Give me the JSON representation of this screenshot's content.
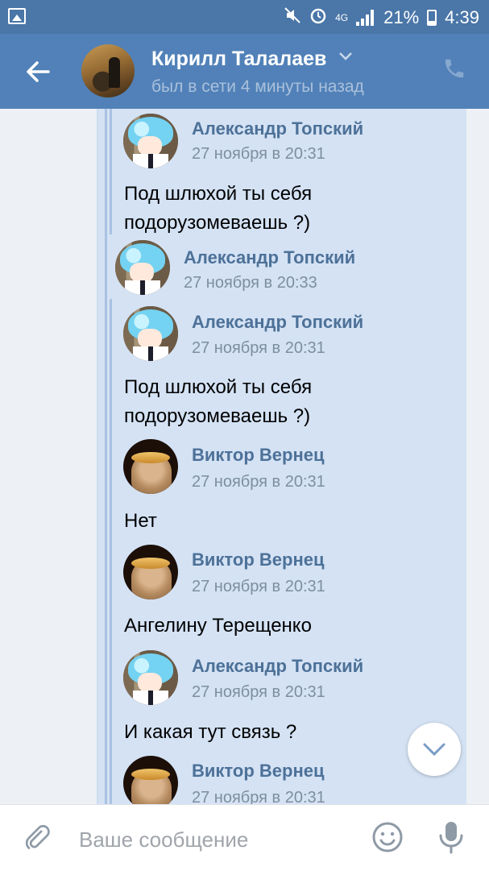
{
  "status_bar": {
    "network": "4G",
    "battery": "21%",
    "time": "4:39",
    "battery_level": 0.21
  },
  "header": {
    "name": "Кирилл Талалаев",
    "status": "был в сети 4 минуты назад"
  },
  "messages": [
    {
      "author": "Александр Топский",
      "date": "27 ноября в 20:31",
      "text": "Под шлюхой ты себя",
      "text2": "подорузомеваешь ?)"
    },
    {
      "author": "Александр Топский",
      "date": "27 ноября в 20:33"
    },
    {
      "author": "Александр Топский",
      "date": "27 ноября в 20:31",
      "text": "Под шлюхой ты себя",
      "text2": "подорузомеваешь ?)"
    },
    {
      "author": "Виктор Вернец",
      "date": "27 ноября в 20:31",
      "text": "Нет"
    },
    {
      "author": "Виктор Вернец",
      "date": "27 ноября в 20:31",
      "text": "Ангелину Терещенко"
    },
    {
      "author": "Александр Топский",
      "date": "27 ноября в 20:31",
      "text": "И какая тут связь ?"
    },
    {
      "author": "Виктор Вернец",
      "date": "27 ноября в 20:31"
    }
  ],
  "input": {
    "placeholder": "Ваше сообщение",
    "value": ""
  },
  "icons": {
    "back": "arrow-left-icon",
    "phone": "phone-icon",
    "attach": "paperclip-icon",
    "emoji": "smile-icon",
    "mic": "microphone-icon",
    "scroll": "chevron-down-icon"
  },
  "colors": {
    "header": "#5181b8",
    "status_bar": "#4a76a8",
    "bubble": "#d4e2f4",
    "author": "#4d7198"
  }
}
